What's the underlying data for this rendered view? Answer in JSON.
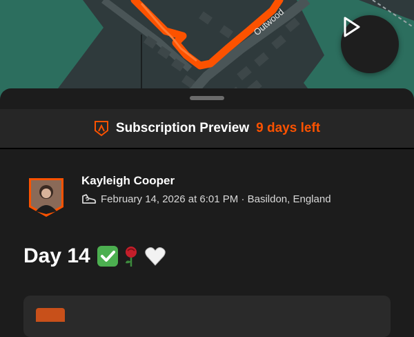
{
  "map": {
    "street_label": "Outwood",
    "play_icon": "play-icon"
  },
  "subscription": {
    "icon": "strava-badge-icon",
    "title": "Subscription Preview",
    "days_left": "9 days left",
    "accent": "#fc5200"
  },
  "athlete": {
    "name": "Kayleigh Cooper",
    "activity_icon": "shoe-icon",
    "meta": "February 14, 2026 at 6:01 PM · Basildon, England"
  },
  "activity": {
    "title": "Day 14",
    "emojis": [
      "check-mark-emoji",
      "rose-emoji",
      "white-heart-emoji"
    ]
  }
}
